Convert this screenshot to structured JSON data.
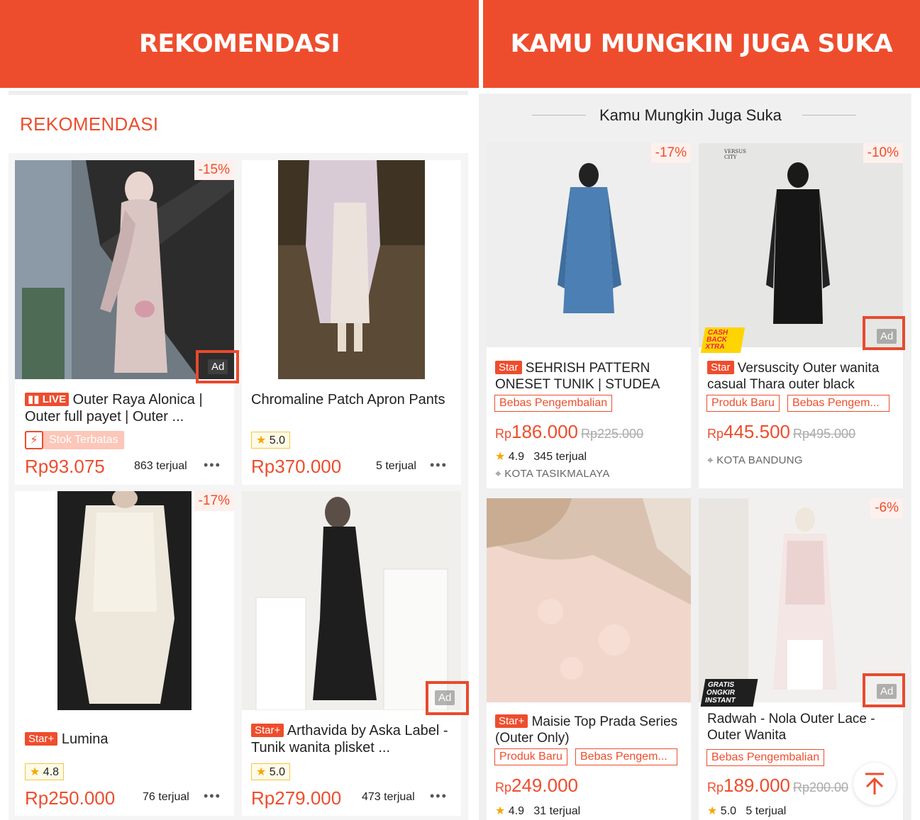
{
  "banners": {
    "left": "REKOMENDASI",
    "right": "KAMU MUNGKIN JUGA SUKA"
  },
  "left_section": {
    "title": "REKOMENDASI"
  },
  "right_section": {
    "title": "Kamu Mungkin Juga Suka"
  },
  "ad_label": "Ad",
  "currency": "Rp",
  "colors": {
    "brand": "#ee4d2d",
    "ad_highlight": "#e84a2d",
    "rating_star": "#f6a700"
  },
  "left_products": [
    {
      "discount": "-15%",
      "tag": "LIVE",
      "name": "Outer Raya Alonica | Outer full payet | Outer ...",
      "stock_label": "Stok Terbatas",
      "price": "Rp93.075",
      "sold": "863 terjual",
      "ad": true
    },
    {
      "discount": "",
      "tag": "",
      "name": "Chromaline Patch Apron Pants",
      "rating": "5.0",
      "price": "Rp370.000",
      "sold": "5 terjual",
      "ad": false
    },
    {
      "discount": "-17%",
      "tag": "Star+",
      "name": "Lumina",
      "rating": "4.8",
      "price": "Rp250.000",
      "sold": "76 terjual",
      "ad": false
    },
    {
      "discount": "",
      "tag": "Star+",
      "name": "Arthavida by Aska Label - Tunik wanita plisket ...",
      "rating": "5.0",
      "price": "Rp279.000",
      "sold": "473 terjual",
      "ad": true
    }
  ],
  "right_products": [
    {
      "discount": "-17%",
      "tag": "Star",
      "name": "SEHRISH PATTERN ONESET TUNIK | STUDEA",
      "chips": [
        "Bebas Pengembalian"
      ],
      "price": "186.000",
      "old_price": "Rp225.000",
      "rating": "4.9",
      "sold": "345 terjual",
      "location": "KOTA TASIKMALAYA",
      "ad": false
    },
    {
      "discount": "-10%",
      "tag": "Star",
      "name": "Versuscity Outer wanita casual Thara outer black",
      "chips": [
        "Produk Baru",
        "Bebas Pengem..."
      ],
      "price": "445.500",
      "old_price": "Rp495.000",
      "location": "KOTA BANDUNG",
      "promo": "CASH BACK XTRA",
      "brand_mark": "VERSUS CITY",
      "ad": true
    },
    {
      "discount": "",
      "tag": "Star+",
      "name": "Maisie Top Prada Series (Outer Only)",
      "chips": [
        "Produk Baru",
        "Bebas Pengem..."
      ],
      "price": "249.000",
      "rating": "4.9",
      "sold": "31 terjual",
      "ad": false
    },
    {
      "discount": "-6%",
      "tag": "",
      "name": "Radwah - Nola Outer Lace - Outer Wanita",
      "chips": [
        "Bebas Pengembalian"
      ],
      "price": "189.000",
      "old_price": "Rp200.00",
      "rating": "5.0",
      "sold": "5 terjual",
      "promo": "GRATIS ONGKIR INSTANT",
      "ad": true
    }
  ]
}
